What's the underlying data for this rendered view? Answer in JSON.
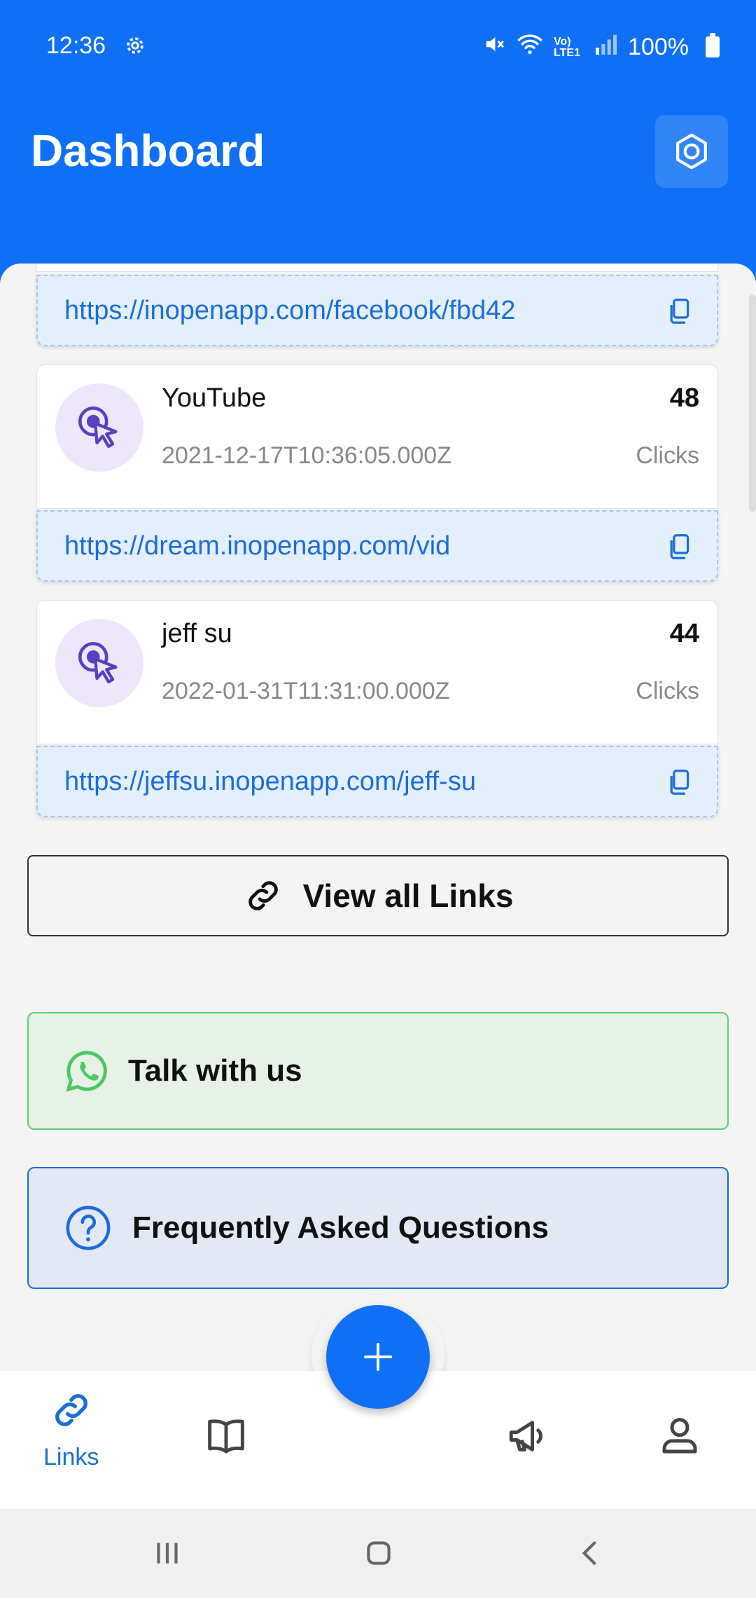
{
  "status_bar": {
    "time": "12:36",
    "battery": "100%",
    "network": "Vo) LTE1"
  },
  "header": {
    "title": "Dashboard"
  },
  "links": [
    {
      "url": "https://inopenapp.com/facebook/fbd42"
    },
    {
      "name": "YouTube",
      "date": "2021-12-17T10:36:05.000Z",
      "clicks": "48",
      "clicks_label": "Clicks",
      "url": "https://dream.inopenapp.com/vid"
    },
    {
      "name": "jeff su",
      "date": "2022-01-31T11:31:00.000Z",
      "clicks": "44",
      "clicks_label": "Clicks",
      "url": "https://jeffsu.inopenapp.com/jeff-su"
    }
  ],
  "actions": {
    "view_all": "View all Links",
    "talk": "Talk with us",
    "faq": "Frequently Asked Questions"
  },
  "nav": {
    "links_label": "Links"
  },
  "colors": {
    "primary": "#1070f5",
    "whatsapp": "#4ac95e",
    "accent_purple": "#5a3fc0"
  }
}
